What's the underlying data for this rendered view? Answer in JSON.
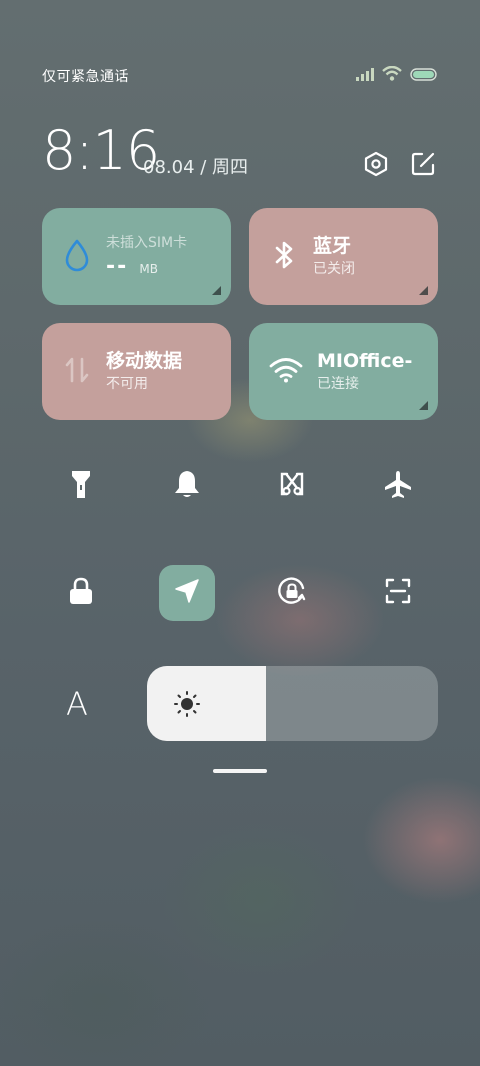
{
  "status_bar": {
    "carrier_text": "仅可紧急通话",
    "icons": [
      "signal-bars-icon",
      "wifi-icon",
      "battery-icon"
    ]
  },
  "header": {
    "time": "8:16",
    "date": "08.04 / 周四",
    "icons": [
      "settings-icon",
      "edit-icon"
    ]
  },
  "tiles": {
    "data_usage": {
      "label": "未插入SIM卡",
      "value": "--",
      "unit": "MB",
      "icon": "water-drop-icon"
    },
    "bluetooth": {
      "title": "蓝牙",
      "status": "已关闭",
      "icon": "bluetooth-icon"
    },
    "mobile_data": {
      "title": "移动数据",
      "status": "不可用",
      "icon": "data-arrows-icon"
    },
    "wifi": {
      "title": "MIOffice-",
      "status": "已连接",
      "icon": "wifi-icon"
    }
  },
  "toggles_row1": [
    "flashlight-icon",
    "bell-icon",
    "screenshot-icon",
    "airplane-icon"
  ],
  "toggles_row2": [
    "lock-icon",
    "location-icon",
    "rotation-lock-icon",
    "scan-icon"
  ],
  "brightness": {
    "auto_label": "A",
    "level": 0.41,
    "icon": "sun-icon"
  },
  "colors": {
    "tile_green": "#82ada0",
    "tile_pink": "#c4a09c",
    "accent_blue": "#2f8cd8"
  }
}
